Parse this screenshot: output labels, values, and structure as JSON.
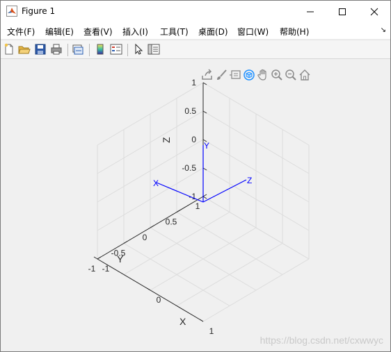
{
  "window": {
    "title": "Figure 1",
    "icons": {
      "app": "matlab-logo-icon",
      "minimize": "minimize-icon",
      "maximize": "maximize-icon",
      "close": "close-icon"
    }
  },
  "menubar": {
    "items": [
      {
        "label": "文件(F)",
        "name": "menu-file"
      },
      {
        "label": "编辑(E)",
        "name": "menu-edit"
      },
      {
        "label": "查看(V)",
        "name": "menu-view"
      },
      {
        "label": "插入(I)",
        "name": "menu-insert"
      },
      {
        "label": "工具(T)",
        "name": "menu-tools"
      },
      {
        "label": "桌面(D)",
        "name": "menu-desktop"
      },
      {
        "label": "窗口(W)",
        "name": "menu-window"
      },
      {
        "label": "帮助(H)",
        "name": "menu-help"
      }
    ],
    "overflow_glyph": "↘"
  },
  "toolbar": {
    "buttons": [
      "new-figure-icon",
      "open-file-icon",
      "save-icon",
      "print-icon",
      "link-plot-icon",
      "colorbar-icon",
      "legend-icon",
      "edit-plot-cursor-icon",
      "property-inspector-icon"
    ]
  },
  "axes_toolbar": {
    "buttons": [
      "export-icon",
      "brush-icon",
      "data-tips-icon",
      "rotate-3d-icon",
      "pan-icon",
      "zoom-in-icon",
      "zoom-out-icon",
      "home-icon"
    ]
  },
  "chart_data": {
    "type": "line",
    "view": "3d",
    "grid": true,
    "xlim": [
      -1,
      1
    ],
    "ylim": [
      -1,
      1
    ],
    "zlim": [
      -1,
      1
    ],
    "xlabel": "X",
    "ylabel": "Y",
    "zlabel": "Z",
    "x_ticks": [
      "-1",
      "0",
      "1"
    ],
    "y_ticks": [
      "-1",
      "-0.5",
      "0",
      "0.5",
      "1"
    ],
    "z_ticks": [
      "-1",
      "-0.5",
      "0",
      "0.5",
      "1"
    ],
    "series": [
      {
        "label": "X",
        "color": "#0000ff",
        "x": [
          0,
          1
        ],
        "y": [
          0,
          0
        ],
        "z": [
          0,
          0
        ]
      },
      {
        "label": "Y",
        "color": "#0000ff",
        "x": [
          0,
          0
        ],
        "y": [
          0,
          1
        ],
        "z": [
          0,
          0
        ]
      },
      {
        "label": "Z",
        "color": "#0000ff",
        "x": [
          0,
          0
        ],
        "y": [
          0,
          0
        ],
        "z": [
          0,
          1
        ]
      }
    ]
  },
  "watermark": "https://blog.csdn.net/cxwwyc"
}
